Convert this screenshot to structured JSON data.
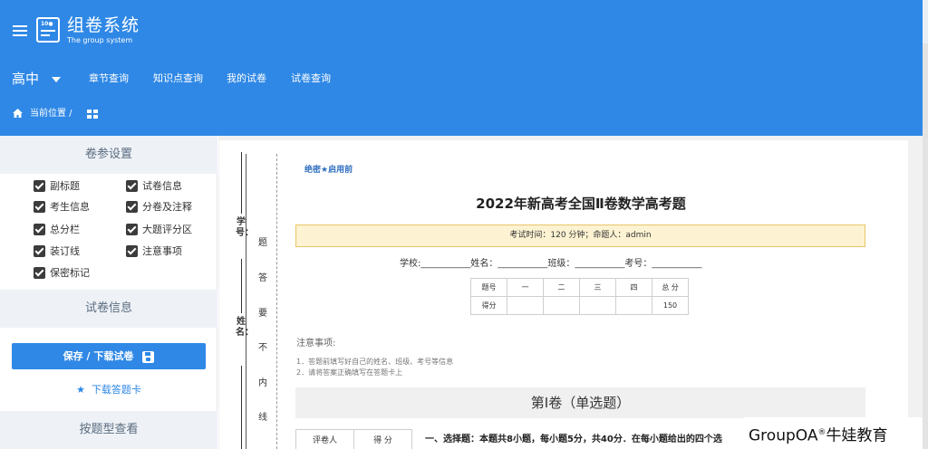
{
  "header": {
    "app_title": "组卷系统",
    "app_subtitle": "The group system",
    "logo_text": "10●",
    "grade": "高中",
    "nav": [
      "章节查询",
      "知识点查询",
      "我的试卷",
      "试卷查询"
    ],
    "breadcrumb": "当前位置 /",
    "accent": "#2f88e6"
  },
  "sidebar": {
    "settings_title": "卷参设置",
    "options": [
      {
        "label": "副标题",
        "checked": true
      },
      {
        "label": "试卷信息",
        "checked": true
      },
      {
        "label": "考生信息",
        "checked": true
      },
      {
        "label": "分卷及注释",
        "checked": true
      },
      {
        "label": "总分栏",
        "checked": true
      },
      {
        "label": "大题评分区",
        "checked": true
      },
      {
        "label": "装订线",
        "checked": true
      },
      {
        "label": "注意事项",
        "checked": true
      },
      {
        "label": "保密标记",
        "checked": true
      }
    ],
    "info_title": "试卷信息",
    "save_label": "保存 / 下载试卷",
    "download_card": "下载答题卡",
    "by_type_title": "按题型查看"
  },
  "paper": {
    "secret_mark": "绝密★启用前",
    "title": "2022年新高考全国Ⅱ卷数学高考题",
    "info": "考试时间：120 分钟；命题人：admin",
    "fields": "学校:___________姓名：___________班级：___________考号：___________",
    "binding_labels": {
      "student_id": "学号：",
      "name": "姓名：",
      "chars": [
        "题",
        "答",
        "要",
        "不",
        "内",
        "线"
      ]
    },
    "score_table": {
      "row1": [
        "题号",
        "一",
        "二",
        "三",
        "四",
        "总 分"
      ],
      "row2": [
        "得分",
        "",
        "",
        "",
        "",
        "150"
      ]
    },
    "notes_title": "注意事项:",
    "notes": [
      "1．答题前填写好自己的姓名、班级、考号等信息",
      "2．请将答案正确填写在答题卡上"
    ],
    "section_title": "第Ⅰ卷（单选题）",
    "grader_table": [
      "评卷人",
      "得 分"
    ],
    "question_text": "一、选择题：本题共8小题，每小题5分，共40分．在每小题给出的四个选"
  },
  "watermark": {
    "text": "GroupOA",
    "mark": "®",
    "org": "牛娃教育"
  }
}
